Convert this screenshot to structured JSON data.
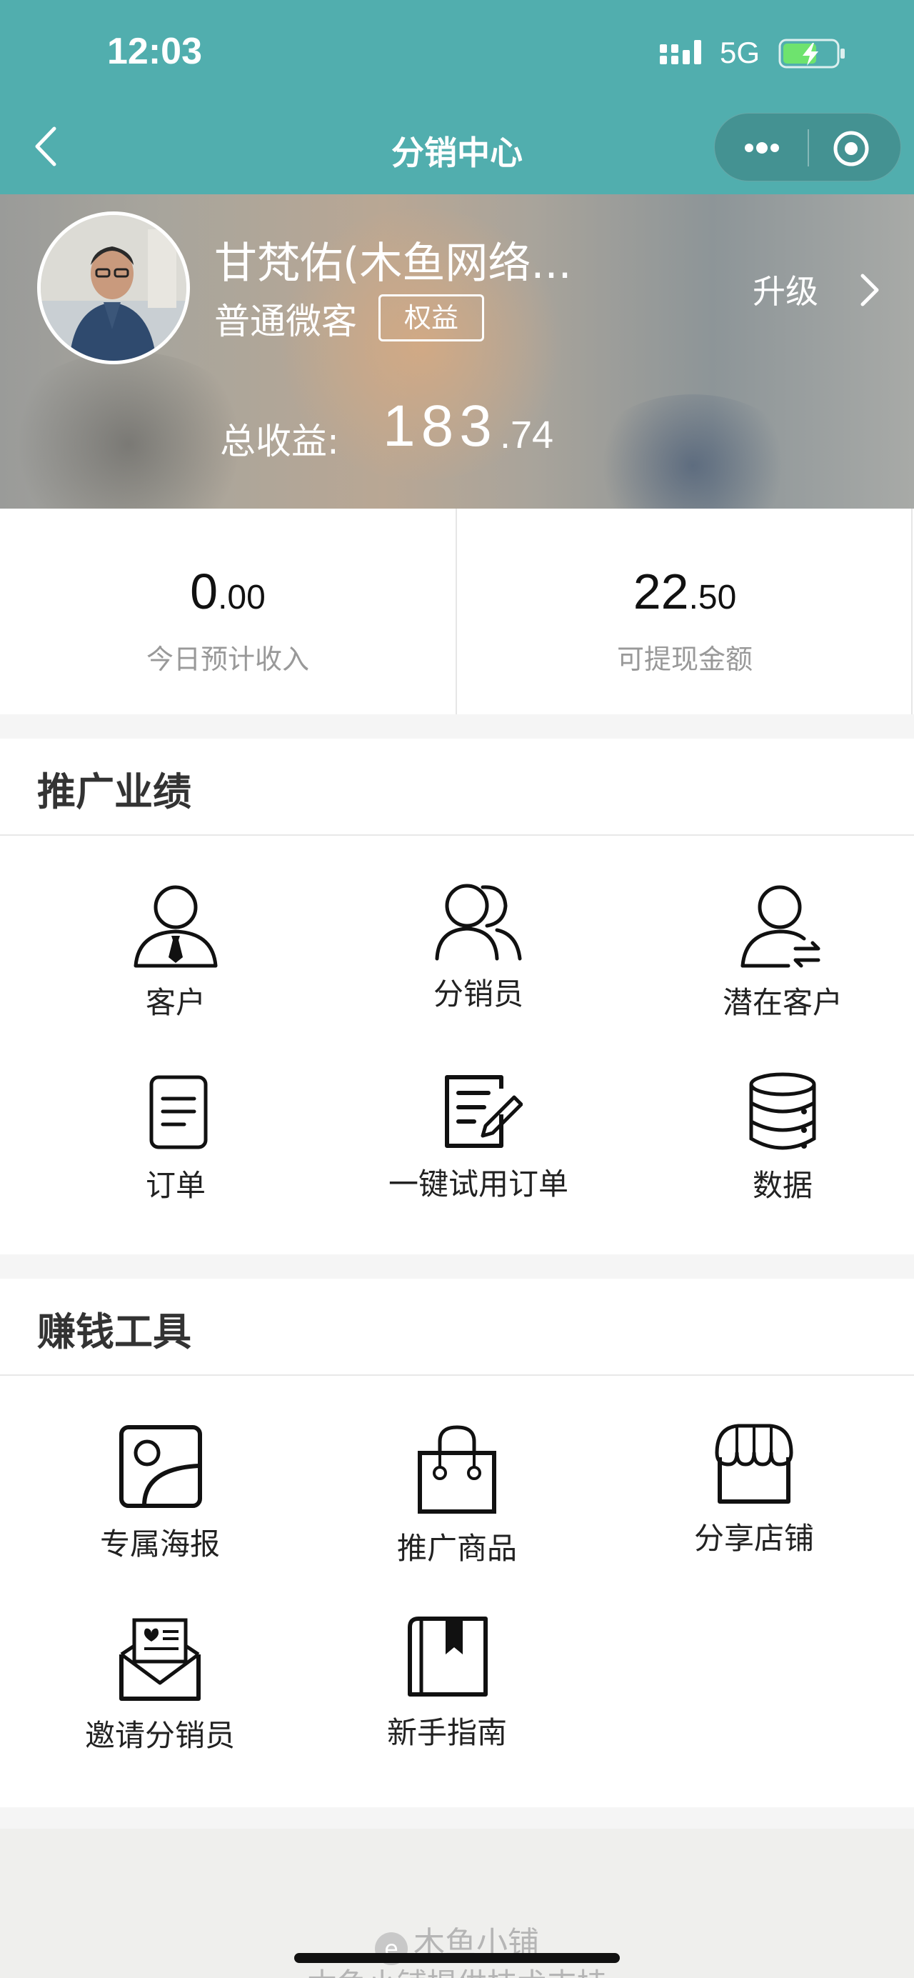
{
  "status_bar": {
    "time": "12:03",
    "network": "5G"
  },
  "nav": {
    "title": "分销中心"
  },
  "profile": {
    "name": "甘梵佑(木鱼网络...",
    "level": "普通微客",
    "rights_label": "权益",
    "upgrade_label": "升级",
    "total_label": "总收益:",
    "total_int": "183",
    "total_dec": ".74"
  },
  "stats": [
    {
      "int": "0",
      "dec": ".00",
      "label": "今日预计收入"
    },
    {
      "int": "22",
      "dec": ".50",
      "label": "可提现金额"
    }
  ],
  "performance": {
    "title": "推广业绩",
    "items": [
      {
        "label": "客户",
        "icon": "customer-icon"
      },
      {
        "label": "分销员",
        "icon": "distributors-icon"
      },
      {
        "label": "潜在客户",
        "icon": "potential-customer-icon"
      },
      {
        "label": "订单",
        "icon": "order-icon"
      },
      {
        "label": "一键试用订单",
        "icon": "trial-order-icon"
      },
      {
        "label": "数据",
        "icon": "database-icon"
      }
    ]
  },
  "tools": {
    "title": "赚钱工具",
    "items": [
      {
        "label": "专属海报",
        "icon": "poster-icon"
      },
      {
        "label": "推广商品",
        "icon": "shopping-bag-icon"
      },
      {
        "label": "分享店铺",
        "icon": "storefront-icon"
      },
      {
        "label": "邀请分销员",
        "icon": "invite-letter-icon"
      },
      {
        "label": "新手指南",
        "icon": "guide-book-icon"
      }
    ]
  },
  "footer": {
    "brand": "木鱼小铺",
    "support": "木鱼小铺提供技术支持"
  },
  "colors": {
    "nav_bg": "#51aeae",
    "page_bg": "#f5f5f5"
  }
}
